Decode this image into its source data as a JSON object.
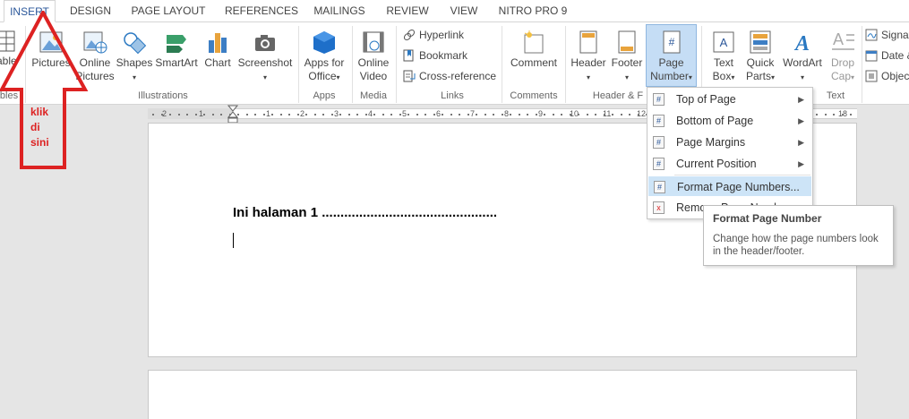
{
  "tabs": [
    {
      "label": "INSERT",
      "active": true
    },
    {
      "label": "DESIGN"
    },
    {
      "label": "PAGE LAYOUT"
    },
    {
      "label": "REFERENCES"
    },
    {
      "label": "MAILINGS"
    },
    {
      "label": "REVIEW"
    },
    {
      "label": "VIEW"
    },
    {
      "label": "NITRO PRO 9"
    }
  ],
  "ribbon": {
    "table_partial": "able",
    "tables_group_partial": "bles",
    "pictures": "Pictures",
    "online_pictures_1": "Online",
    "online_pictures_2": "Pictures",
    "shapes": "Shapes",
    "smartart": "SmartArt",
    "chart": "Chart",
    "screenshot": "Screenshot",
    "illustrations_group": "Illustrations",
    "apps_1": "Apps for",
    "apps_2": "Office",
    "apps_group": "Apps",
    "online_video_1": "Online",
    "online_video_2": "Video",
    "media_group": "Media",
    "hyperlink": "Hyperlink",
    "bookmark": "Bookmark",
    "cross_reference": "Cross-reference",
    "links_group": "Links",
    "comment": "Comment",
    "comments_group": "Comments",
    "header": "Header",
    "footer": "Footer",
    "page_number_1": "Page",
    "page_number_2": "Number",
    "header_footer_group": "Header & F",
    "text_box_1": "Text",
    "text_box_2": "Box",
    "quick_parts_1": "Quick",
    "quick_parts_2": "Parts",
    "wordart": "WordArt",
    "drop_cap_1": "Drop",
    "drop_cap_2": "Cap",
    "text_group": "Text",
    "signature": "Signat",
    "date_time": "Date &",
    "object": "Objec"
  },
  "ruler": {
    "numbers": [
      "2",
      "1",
      "1",
      "2",
      "3",
      "4",
      "5",
      "6",
      "7",
      "8",
      "9",
      "10",
      "11",
      "12",
      "18"
    ]
  },
  "document": {
    "line1": "Ini halaman 1 ..............................................."
  },
  "menu": {
    "items": [
      {
        "label": "Top of Page",
        "icon": "#",
        "submenu": true
      },
      {
        "label": "Bottom of Page",
        "icon": "#",
        "submenu": true
      },
      {
        "label": "Page Margins",
        "icon": "#",
        "submenu": true
      },
      {
        "label": "Current Position",
        "icon": "#",
        "submenu": true
      },
      {
        "label": "Format Page Numbers...",
        "icon": "#",
        "submenu": false,
        "highlighted": true
      },
      {
        "label": "Remove Page Numbers",
        "icon": "x",
        "submenu": false
      }
    ]
  },
  "tooltip": {
    "title": "Format Page Number",
    "description": "Change how the page numbers look in the header/footer."
  },
  "annotation": {
    "line1": "klik",
    "line2": "di",
    "line3": "sini",
    "color": "#dd2222"
  }
}
